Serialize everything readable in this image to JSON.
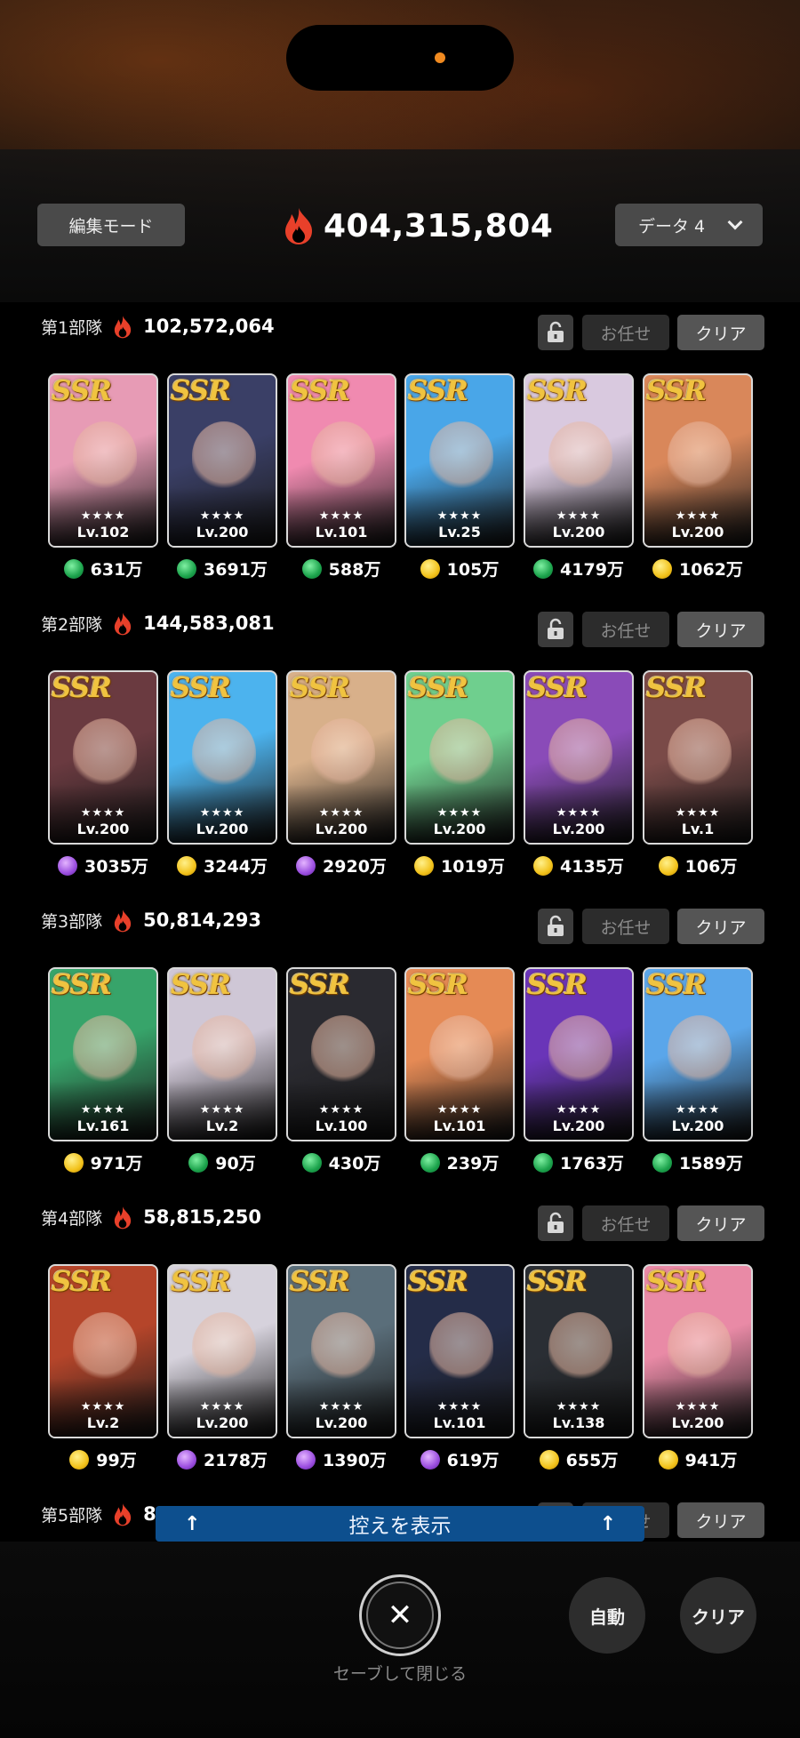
{
  "header": {
    "edit_mode": "編集モード",
    "total_power": "404,315,804",
    "data_slot": "データ 4"
  },
  "colors": {
    "flame": "#e8402a",
    "reserve_bar": "#0d4f8e",
    "ssr_gold": "#f0c340"
  },
  "squad_buttons": {
    "omakase": "お任せ",
    "clear": "クリア"
  },
  "squads": [
    {
      "label": "第1部隊",
      "power": "102,572,064",
      "cards": [
        {
          "rarity": "SSR",
          "stars": "★★★★",
          "level": "Lv.102",
          "currency": "green",
          "power": "631万",
          "hue": "#e79bb5"
        },
        {
          "rarity": "SSR",
          "stars": "★★★★",
          "level": "Lv.200",
          "currency": "green",
          "power": "3691万",
          "hue": "#3a3f66"
        },
        {
          "rarity": "SSR",
          "stars": "★★★★",
          "level": "Lv.101",
          "currency": "green",
          "power": "588万",
          "hue": "#f08ab0"
        },
        {
          "rarity": "SSR",
          "stars": "★★★★",
          "level": "Lv.25",
          "currency": "gold",
          "power": "105万",
          "hue": "#49a6e8"
        },
        {
          "rarity": "SSR",
          "stars": "★★★★",
          "level": "Lv.200",
          "currency": "green",
          "power": "4179万",
          "hue": "#d9c9df"
        },
        {
          "rarity": "SSR",
          "stars": "★★★★",
          "level": "Lv.200",
          "currency": "gold",
          "power": "1062万",
          "hue": "#d9875a"
        }
      ]
    },
    {
      "label": "第2部隊",
      "power": "144,583,081",
      "cards": [
        {
          "rarity": "SSR",
          "stars": "★★★★",
          "level": "Lv.200",
          "currency": "purple",
          "power": "3035万",
          "hue": "#6a3a40"
        },
        {
          "rarity": "SSR",
          "stars": "★★★★",
          "level": "Lv.200",
          "currency": "gold",
          "power": "3244万",
          "hue": "#4cb3ee"
        },
        {
          "rarity": "SSR",
          "stars": "★★★★",
          "level": "Lv.200",
          "currency": "purple",
          "power": "2920万",
          "hue": "#d8b08a"
        },
        {
          "rarity": "SSR",
          "stars": "★★★★",
          "level": "Lv.200",
          "currency": "gold",
          "power": "1019万",
          "hue": "#6fcf8e"
        },
        {
          "rarity": "SSR",
          "stars": "★★★★",
          "level": "Lv.200",
          "currency": "gold",
          "power": "4135万",
          "hue": "#8a4bb8"
        },
        {
          "rarity": "SSR",
          "stars": "★★★★",
          "level": "Lv.1",
          "currency": "gold",
          "power": "106万",
          "hue": "#7a4a48"
        }
      ]
    },
    {
      "label": "第3部隊",
      "power": "50,814,293",
      "cards": [
        {
          "rarity": "SSR",
          "stars": "★★★★",
          "level": "Lv.161",
          "currency": "gold",
          "power": "971万",
          "hue": "#37a46a"
        },
        {
          "rarity": "SSR",
          "stars": "★★★★",
          "level": "Lv.2",
          "currency": "green",
          "power": "90万",
          "hue": "#cfc7d6"
        },
        {
          "rarity": "SSR",
          "stars": "★★★★",
          "level": "Lv.100",
          "currency": "green",
          "power": "430万",
          "hue": "#2a2a30"
        },
        {
          "rarity": "SSR",
          "stars": "★★★★",
          "level": "Lv.101",
          "currency": "green",
          "power": "239万",
          "hue": "#e58a55"
        },
        {
          "rarity": "SSR",
          "stars": "★★★★",
          "level": "Lv.200",
          "currency": "green",
          "power": "1763万",
          "hue": "#6a35b8"
        },
        {
          "rarity": "SSR",
          "stars": "★★★★",
          "level": "Lv.200",
          "currency": "green",
          "power": "1589万",
          "hue": "#5aa6ea"
        }
      ]
    },
    {
      "label": "第4部隊",
      "power": "58,815,250",
      "cards": [
        {
          "rarity": "SSR",
          "stars": "★★★★",
          "level": "Lv.2",
          "currency": "gold",
          "power": "99万",
          "hue": "#b5452a"
        },
        {
          "rarity": "SSR",
          "stars": "★★★★",
          "level": "Lv.200",
          "currency": "purple",
          "power": "2178万",
          "hue": "#d6d2dc"
        },
        {
          "rarity": "SSR",
          "stars": "★★★★",
          "level": "Lv.200",
          "currency": "purple",
          "power": "1390万",
          "hue": "#5a6e7a"
        },
        {
          "rarity": "SSR",
          "stars": "★★★★",
          "level": "Lv.101",
          "currency": "purple",
          "power": "619万",
          "hue": "#242c48"
        },
        {
          "rarity": "SSR",
          "stars": "★★★★",
          "level": "Lv.138",
          "currency": "gold",
          "power": "655万",
          "hue": "#2a2e34"
        },
        {
          "rarity": "SSR",
          "stars": "★★★★",
          "level": "Lv.200",
          "currency": "gold",
          "power": "941万",
          "hue": "#e98aa6"
        }
      ]
    },
    {
      "label": "第5部隊",
      "power": "8",
      "cards": []
    }
  ],
  "reserve": {
    "label": "控えを表示"
  },
  "footer": {
    "close_label": "セーブして閉じる",
    "auto": "自動",
    "clear": "クリア"
  }
}
